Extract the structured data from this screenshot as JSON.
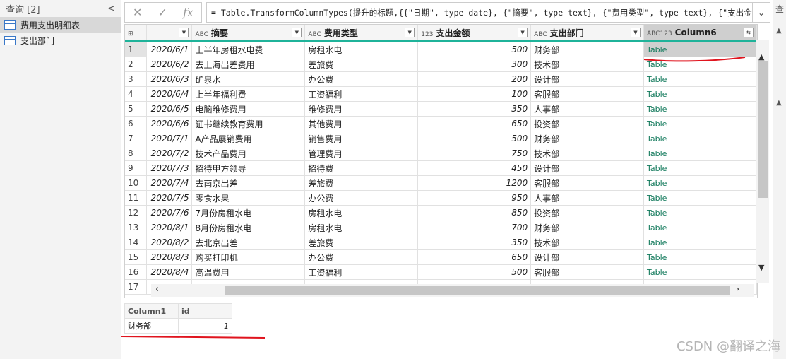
{
  "queries_panel": {
    "header": "查询 [2]",
    "collapse_glyph": "<",
    "items": [
      {
        "label": "费用支出明细表",
        "selected": true
      },
      {
        "label": "支出部门",
        "selected": false
      }
    ]
  },
  "right_panel_label": "查",
  "formula_bar": {
    "cancel_glyph": "✕",
    "commit_glyph": "✓",
    "fx_glyph": "fx",
    "formula": "= Table.TransformColumnTypes(提升的标题,{{\"日期\", type date}, {\"摘要\", type text}, {\"费用类型\", type text}, {\"支出金额",
    "expand_glyph": "⌄"
  },
  "grid": {
    "columns": [
      {
        "name": "",
        "type_icon": "⊞"
      },
      {
        "name": "",
        "type_icon": ""
      },
      {
        "name": "摘要",
        "type_icon": "ABC"
      },
      {
        "name": "费用类型",
        "type_icon": "ABC"
      },
      {
        "name": "支出金额",
        "type_icon": "123"
      },
      {
        "name": "支出部门",
        "type_icon": "ABC"
      },
      {
        "name": "Column6",
        "type_icon": "ABC123"
      }
    ],
    "rows": [
      {
        "n": "1",
        "date": "2020/6/1",
        "summary": "上半年房租水电费",
        "type": "房租水电",
        "amount": "500",
        "dept": "财务部",
        "col6": "Table"
      },
      {
        "n": "2",
        "date": "2020/6/2",
        "summary": "去上海出差费用",
        "type": "差旅费",
        "amount": "300",
        "dept": "技术部",
        "col6": "Table"
      },
      {
        "n": "3",
        "date": "2020/6/3",
        "summary": "矿泉水",
        "type": "办公费",
        "amount": "200",
        "dept": "设计部",
        "col6": "Table"
      },
      {
        "n": "4",
        "date": "2020/6/4",
        "summary": "上半年福利费",
        "type": "工资福利",
        "amount": "100",
        "dept": "客服部",
        "col6": "Table"
      },
      {
        "n": "5",
        "date": "2020/6/5",
        "summary": "电脑维修费用",
        "type": "维修费用",
        "amount": "350",
        "dept": "人事部",
        "col6": "Table"
      },
      {
        "n": "6",
        "date": "2020/6/6",
        "summary": "证书继续教育费用",
        "type": "其他费用",
        "amount": "650",
        "dept": "投资部",
        "col6": "Table"
      },
      {
        "n": "7",
        "date": "2020/7/1",
        "summary": "A产品展销费用",
        "type": "销售费用",
        "amount": "500",
        "dept": "财务部",
        "col6": "Table"
      },
      {
        "n": "8",
        "date": "2020/7/2",
        "summary": "技术产品费用",
        "type": "管理费用",
        "amount": "750",
        "dept": "技术部",
        "col6": "Table"
      },
      {
        "n": "9",
        "date": "2020/7/3",
        "summary": "招待甲方领导",
        "type": "招待费",
        "amount": "450",
        "dept": "设计部",
        "col6": "Table"
      },
      {
        "n": "10",
        "date": "2020/7/4",
        "summary": "去南京出差",
        "type": "差旅费",
        "amount": "1200",
        "dept": "客服部",
        "col6": "Table"
      },
      {
        "n": "11",
        "date": "2020/7/5",
        "summary": "零食水果",
        "type": "办公费",
        "amount": "950",
        "dept": "人事部",
        "col6": "Table"
      },
      {
        "n": "12",
        "date": "2020/7/6",
        "summary": "7月份房租水电",
        "type": "房租水电",
        "amount": "850",
        "dept": "投资部",
        "col6": "Table"
      },
      {
        "n": "13",
        "date": "2020/8/1",
        "summary": "8月份房租水电",
        "type": "房租水电",
        "amount": "700",
        "dept": "财务部",
        "col6": "Table"
      },
      {
        "n": "14",
        "date": "2020/8/2",
        "summary": "去北京出差",
        "type": "差旅费",
        "amount": "350",
        "dept": "技术部",
        "col6": "Table"
      },
      {
        "n": "15",
        "date": "2020/8/3",
        "summary": "购买打印机",
        "type": "办公费",
        "amount": "650",
        "dept": "设计部",
        "col6": "Table"
      },
      {
        "n": "16",
        "date": "2020/8/4",
        "summary": "高温费用",
        "type": "工资福利",
        "amount": "500",
        "dept": "客服部",
        "col6": "Table"
      },
      {
        "n": "17",
        "date": "",
        "summary": "",
        "type": "",
        "amount": "",
        "dept": "",
        "col6": ""
      }
    ]
  },
  "detail": {
    "headers": [
      "Column1",
      "id"
    ],
    "row": [
      "财务部",
      "1"
    ]
  },
  "watermark": "CSDN @翻译之海",
  "colors": {
    "accent_teal": "#1fb39a",
    "annotation_red": "#e0141e",
    "table_link": "#137a5c"
  }
}
